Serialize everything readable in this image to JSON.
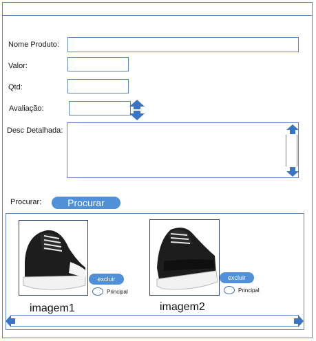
{
  "form": {
    "nome_label": "Nome Produto:",
    "valor_label": "Valor:",
    "qtd_label": "Qtd:",
    "avaliacao_label": "Avaliação:",
    "desc_label": "Desc Detalhada:",
    "procurar_label": "Procurar:",
    "procurar_button": "Procurar"
  },
  "gallery": {
    "items": [
      {
        "caption": "imagem1",
        "delete_label": "excluir",
        "principal_label": "Principal"
      },
      {
        "caption": "imagem2",
        "delete_label": "excluir",
        "principal_label": "Principal"
      }
    ]
  },
  "colors": {
    "accent": "#4f90d9",
    "border": "#5b86c4",
    "arrow": "#3a74c4"
  }
}
